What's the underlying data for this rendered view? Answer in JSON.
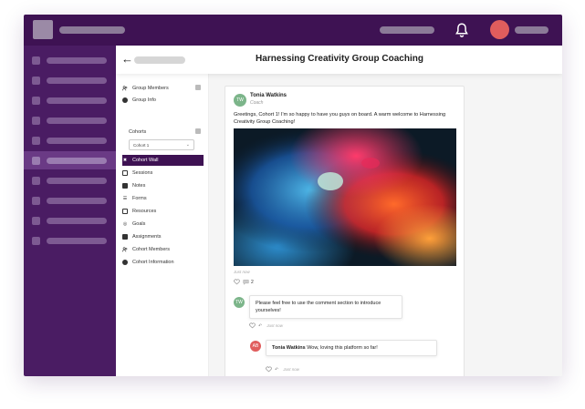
{
  "page": {
    "title": "Harnessing Creativity Group Coaching"
  },
  "nav": {
    "group_members": "Group Members",
    "group_info": "Group Info",
    "cohorts_label": "Cohorts",
    "cohort_selected": "Cohort 1",
    "items": [
      {
        "label": "Cohort Wall",
        "icon": "puzzle-icon"
      },
      {
        "label": "Sessions",
        "icon": "calendar-icon"
      },
      {
        "label": "Notes",
        "icon": "note-icon"
      },
      {
        "label": "Forms",
        "icon": "list-icon"
      },
      {
        "label": "Resources",
        "icon": "folder-icon"
      },
      {
        "label": "Goals",
        "icon": "target-icon"
      },
      {
        "label": "Assignments",
        "icon": "assignment-icon"
      },
      {
        "label": "Cohort Members",
        "icon": "people-icon"
      },
      {
        "label": "Cohort Information",
        "icon": "info-icon"
      }
    ]
  },
  "post": {
    "author_initials": "TW",
    "author_name": "Tonia Watkins",
    "author_role": "Coach",
    "text": "Greetings, Cohort 1! I'm so happy to have you guys on board. A warm welcome to Harnessing Creativity Group Coaching!",
    "time": "Just now",
    "comment_count": "2"
  },
  "comments": [
    {
      "initials": "TW",
      "text": "Please feel free to use the comment section to introduce yourselves!",
      "time": "Just now"
    },
    {
      "initials": "AB",
      "author": "Tonia Watkins",
      "text": "Wow, loving this platform so far!",
      "time": "Just now"
    }
  ],
  "colors": {
    "topbar": "#3e1253",
    "sidebar": "#4a1c63",
    "accent_red": "#e05d5d",
    "avatar_green": "#7cb58a"
  }
}
